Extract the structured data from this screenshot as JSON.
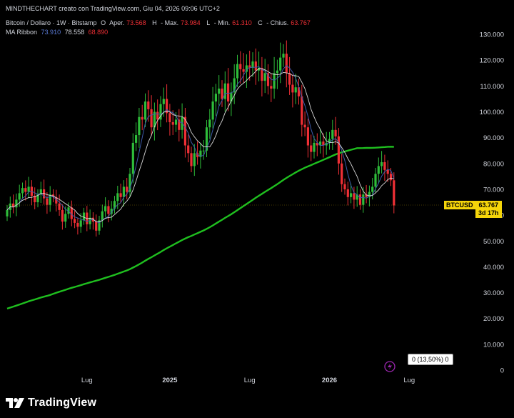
{
  "header": {
    "creator_line": "MINDTHECHART creato con TradingView.com, Giu 04, 2026 09:06 UTC+2",
    "symbol_line": "Bitcoin / Dollaro · 1W · Bitstamp",
    "ohlc": [
      {
        "label": "O",
        "name": "Aper.",
        "value": "73.568"
      },
      {
        "label": "H",
        "name": "Max.",
        "value": "73.984"
      },
      {
        "label": "L",
        "name": "Min.",
        "value": "61.310"
      },
      {
        "label": "C",
        "name": "Chius.",
        "value": "63.767"
      }
    ],
    "indicator_name": "MA Ribbon",
    "indicator_values": [
      "73.910",
      "78.558",
      "68.890"
    ]
  },
  "colors": {
    "background": "#000000",
    "up": "#26a69a",
    "up_bright": "#2ebd3a",
    "down": "#ef2f35",
    "ma_fast": "#3d5aa8",
    "ma_mid": "#d8d8d8",
    "ma_slow": "#1fbf1f",
    "price_label": "#f5d50a",
    "ohlc_value": "#ef2f35",
    "ribbon_v1": "#5b7bd6",
    "ribbon_v2": "#d1d4dc",
    "ribbon_v3": "#ef2f35"
  },
  "price_label": {
    "symbol": "BTCUSD",
    "price": "63.767",
    "countdown": "3d 17h"
  },
  "data_window": {
    "text": "0 (13,50%) 0"
  },
  "branding": {
    "name": "TradingView",
    "logo_icon": "tradingview-logo-icon"
  },
  "chart_data": {
    "type": "candlestick",
    "title": "Bitcoin / Dollaro · 1W · Bitstamp",
    "timeframe": "1W",
    "y_axis": {
      "ylim": [
        0,
        135000
      ],
      "ticks": [
        0,
        10000,
        20000,
        30000,
        40000,
        50000,
        60000,
        70000,
        80000,
        90000,
        100000,
        110000,
        120000,
        130000
      ],
      "tick_labels": [
        "0",
        "10.000",
        "20.000",
        "30.000",
        "40.000",
        "50.000",
        "60.000",
        "70.000",
        "80.000",
        "90.000",
        "100.000",
        "110.000",
        "120.000",
        "130.000"
      ]
    },
    "x_axis": {
      "ticks": [
        "Lug",
        "2025",
        "Lug",
        "2026",
        "Lug"
      ],
      "tick_weeks": [
        26,
        53,
        79,
        105,
        131
      ]
    },
    "grid": false,
    "last_price": 63767,
    "closes": [
      62000,
      64500,
      63000,
      66000,
      68500,
      70500,
      69000,
      71000,
      67500,
      65000,
      68000,
      70000,
      66500,
      64000,
      68000,
      67000,
      64500,
      62000,
      57500,
      60500,
      63000,
      58500,
      57000,
      55500,
      58000,
      61000,
      56500,
      59000,
      57500,
      54000,
      58000,
      61500,
      63500,
      60500,
      62500,
      65500,
      68500,
      67000,
      71000,
      69000,
      76000,
      88000,
      91000,
      98000,
      97000,
      104000,
      101000,
      94000,
      100000,
      97000,
      103000,
      105000,
      99500,
      96000,
      95000,
      97000,
      93000,
      98000,
      87000,
      84000,
      79000,
      84000,
      82500,
      85000,
      85000,
      94000,
      97000,
      104000,
      107000,
      109000,
      105000,
      111000,
      104000,
      107500,
      113000,
      118500,
      116500,
      115500,
      118000,
      117000,
      119500,
      116000,
      117000,
      112000,
      115000,
      110000,
      109000,
      115000,
      116000,
      121000,
      122500,
      115000,
      110500,
      107500,
      109500,
      106000,
      95000,
      94000,
      87000,
      84500,
      88000,
      87000,
      88500,
      87000,
      88000,
      89500,
      93000,
      90500,
      80000,
      72000,
      70000,
      67000,
      68500,
      66000,
      68000,
      64000,
      68000,
      67000,
      69000,
      71000,
      76000,
      79000,
      80500,
      77500,
      76000,
      73500,
      63767
    ],
    "series": [
      {
        "name": "MA Ribbon 1",
        "value": 73910
      },
      {
        "name": "MA Ribbon 2",
        "value": 78558
      },
      {
        "name": "MA Ribbon 3",
        "value": 68890
      }
    ]
  }
}
